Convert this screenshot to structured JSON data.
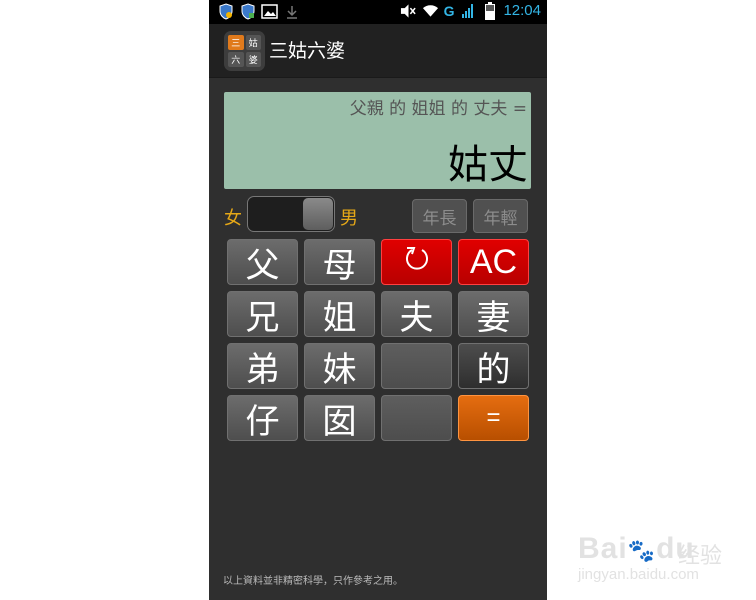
{
  "status_bar": {
    "left_icons": [
      "shield-icon",
      "shield-icon",
      "image-icon",
      "download-icon"
    ],
    "right_icons": [
      "mute-icon",
      "wifi-icon",
      "signal-icon",
      "battery-icon"
    ],
    "network": "G",
    "time": "12:04"
  },
  "app": {
    "icon_chars": [
      "三",
      "姑",
      "六",
      "婆"
    ],
    "title": "三姑六婆"
  },
  "display": {
    "expression": "父親 的 姐姐 的 丈夫 =",
    "result": "姑丈"
  },
  "gender": {
    "female": "女",
    "male": "男",
    "selected": "男"
  },
  "age": {
    "older": "年長",
    "younger": "年輕"
  },
  "keys": {
    "father": "父",
    "mother": "母",
    "undo": "↺",
    "clear": "AC",
    "brother": "兄",
    "elder_sister": "姐",
    "husband": "夫",
    "wife": "妻",
    "younger_brother": "弟",
    "younger_sister": "妹",
    "of": "的",
    "son": "仔",
    "daughter": "囡",
    "equals": "="
  },
  "footer": "以上資料並非精密科學，只作參考之用。",
  "watermark": {
    "brand": "经验",
    "url": "jingyan.baidu.com"
  },
  "colors": {
    "accent_label": "#e6a817",
    "display_bg": "#9bbfaa",
    "key_red": "#d40000",
    "key_orange": "#d86000",
    "status_blue": "#33b5e5"
  }
}
